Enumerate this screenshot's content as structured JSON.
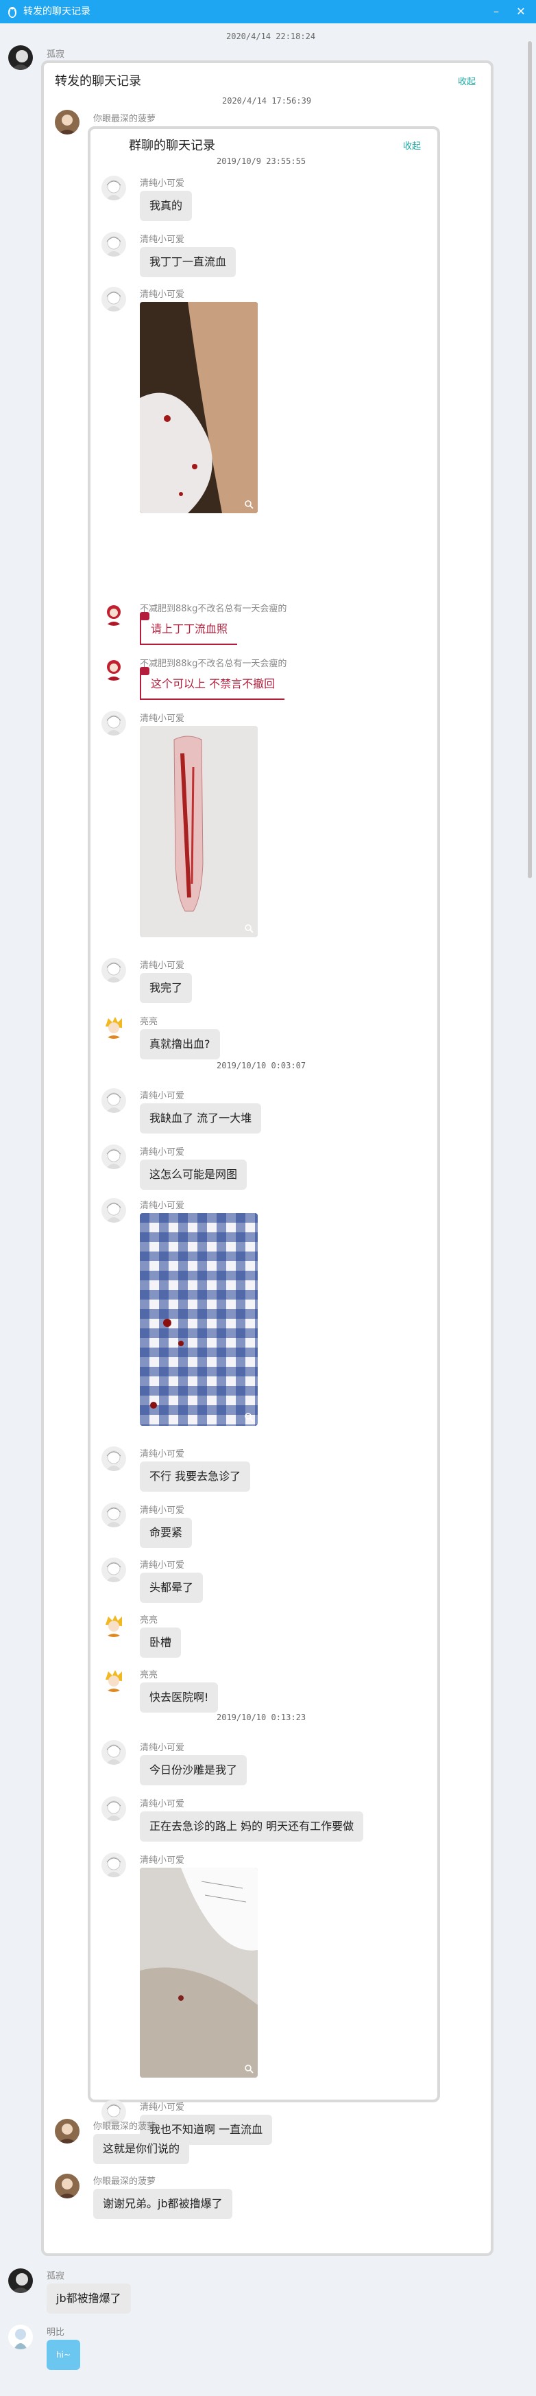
{
  "window": {
    "title": "转发的聊天记录",
    "minimize": "–",
    "close": "✕",
    "icon": "qq-penguin-icon"
  },
  "outer": {
    "timestamp": "2020/4/14 22:18:24",
    "first_sender": "孤寂",
    "card_title": "转发的聊天记录",
    "collapse": "收起",
    "card_timestamp": "2020/4/14 17:56:39",
    "card_sender": "你眼最深的菠萝"
  },
  "inner": {
    "card_title": "群聊的聊天记录",
    "collapse": "收起",
    "timestamps": [
      "2019/10/9 23:55:55",
      "2019/10/10 0:03:07",
      "2019/10/10 0:13:23"
    ],
    "messages": [
      {
        "sender": "清纯小可爱",
        "text": "我真的"
      },
      {
        "sender": "清纯小可爱",
        "text": "我丁丁一直流血"
      },
      {
        "sender": "清纯小可爱",
        "text": ""
      },
      {
        "sender": "不减肥到88kg不改名总有一天会瘦的",
        "text": "请上丁丁流血照"
      },
      {
        "sender": "不减肥到88kg不改名总有一天会瘦的",
        "text": "这个可以上 不禁言不撤回"
      },
      {
        "sender": "清纯小可爱",
        "text": ""
      },
      {
        "sender": "清纯小可爱",
        "text": "我完了"
      },
      {
        "sender": "亮亮",
        "text": "真就撸出血?"
      },
      {
        "sender": "清纯小可爱",
        "text": "我缺血了 流了一大堆"
      },
      {
        "sender": "清纯小可爱",
        "text": "这怎么可能是网图"
      },
      {
        "sender": "清纯小可爱",
        "text": ""
      },
      {
        "sender": "清纯小可爱",
        "text": "不行 我要去急诊了"
      },
      {
        "sender": "清纯小可爱",
        "text": "命要紧"
      },
      {
        "sender": "清纯小可爱",
        "text": "头都晕了"
      },
      {
        "sender": "亮亮",
        "text": "卧槽"
      },
      {
        "sender": "亮亮",
        "text": "快去医院啊!"
      },
      {
        "sender": "清纯小可爱",
        "text": "今日份沙雕是我了"
      },
      {
        "sender": "清纯小可爱",
        "text": "正在去急诊的路上 妈的 明天还有工作要做"
      },
      {
        "sender": "清纯小可爱",
        "text": ""
      },
      {
        "sender": "清纯小可爱",
        "text": "我也不知道啊 一直流血"
      }
    ]
  },
  "after_inner": [
    {
      "sender": "你眼最深的菠萝",
      "text": "这就是你们说的"
    },
    {
      "sender": "你眼最深的菠萝",
      "text": "谢谢兄弟。jb都被撸爆了"
    }
  ],
  "bottom": [
    {
      "sender": "孤寂",
      "text": "jb都被撸爆了"
    },
    {
      "sender": "明比",
      "text": "hi~"
    }
  ],
  "colors": {
    "titlebar": "#1fa6f3",
    "accent": "#1fa6a0",
    "red_tag": "#b41e3c",
    "bubble": "#e9e9e9"
  }
}
